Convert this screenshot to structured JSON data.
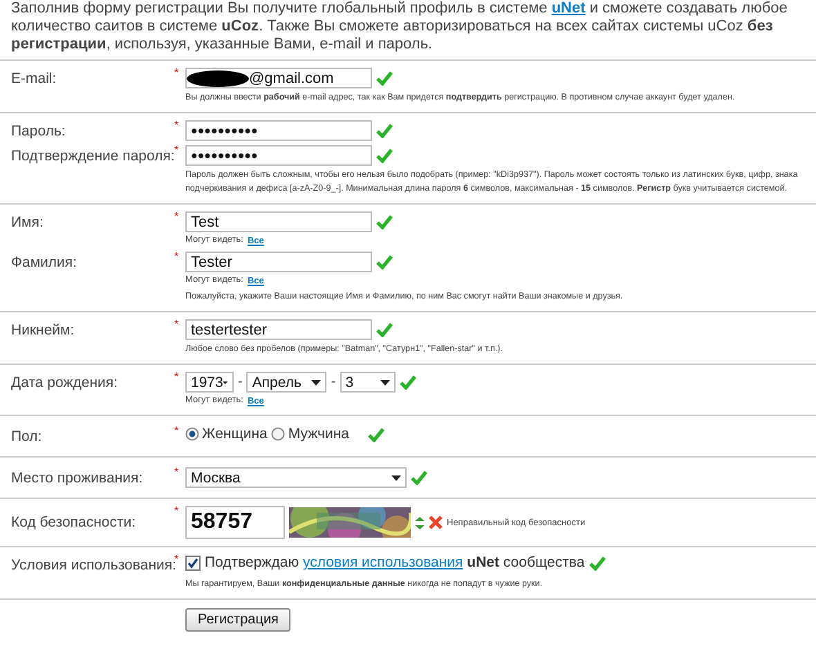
{
  "intro": {
    "before": "Заполнив форму регистрации Вы получите глобальный профиль в системе",
    "link": "uNet",
    "after": "и сможете создавать любое количество саитов в системе **uCoz**. Также Вы сможете авторизироваться на всех сайтах системы uCoz **без регистрации**, используя, указанные Вами, e-mail и пароль."
  },
  "sections": [
    {
      "rows": [
        {
          "kind": "text",
          "label": "E-mail:",
          "required": "*",
          "value": "@gmail.com",
          "redacted": true,
          "valid": true
        }
      ],
      "hint": "Вы должны ввести **рабочий** e-mail адрес, так как Вам придется **подтвердить** регистрацию. В противном случае аккаунт будет удален."
    },
    {
      "rows": [
        {
          "kind": "password",
          "label": "Пароль:",
          "required": "*",
          "value": "●●●●●●●●●●",
          "valid": true
        },
        {
          "kind": "password",
          "label": "Подтверждение пароля:",
          "required": "*",
          "value": "●●●●●●●●●●",
          "valid": true
        }
      ],
      "hint": "Пароль должен быть сложным, чтобы его нельзя было подобрать (пример: \"kDi3p937\"). Пароль может состоять только из латинских букв, цифр, знака подчеркивания и дефиса [a-zA-Z0-9_-]. Минимальная длина пароля **6** символов, максимальная - **15** символов. **Регистр** букв учитывается системой."
    },
    {
      "rows": [
        {
          "kind": "text",
          "label": "Имя:",
          "required": "*",
          "value": "Test",
          "valid": true,
          "visibility": {
            "label": "Могут видеть:",
            "link": "Все"
          }
        },
        {
          "kind": "text",
          "label": "Фамилия:",
          "required": "*",
          "value": "Tester",
          "valid": true,
          "visibility": {
            "label": "Могут видеть:",
            "link": "Все"
          }
        }
      ],
      "hint": "Пожалуйста, укажите Ваши настоящие Имя и Фамилию, по ним Вас смогут найти Ваши знакомые и друзья."
    },
    {
      "rows": [
        {
          "kind": "text",
          "label": "Никнейм:",
          "required": "*",
          "value": "testertester",
          "valid": true
        }
      ],
      "hint": "Любое слово без пробелов (примеры: \"Batman\", \"Сатурн1\", \"Fallen-star\" и т.п.)."
    },
    {
      "rows": [
        {
          "kind": "date",
          "label": "Дата рождения:",
          "required": "*",
          "selects": [
            "1973",
            "Апрель",
            "3"
          ],
          "separator": "-",
          "valid": true,
          "visibility": {
            "label": "Могут видеть:",
            "link": "Все"
          }
        }
      ]
    },
    {
      "rows": [
        {
          "kind": "radio",
          "label": "Пол:",
          "required": "*",
          "options": [
            {
              "label": "Женщина",
              "selected": true
            },
            {
              "label": "Мужчина",
              "selected": false
            }
          ],
          "valid": true
        }
      ]
    },
    {
      "rows": [
        {
          "kind": "select",
          "label": "Место проживания:",
          "required": "*",
          "value": "Москва",
          "valid": true
        }
      ]
    },
    {
      "rows": [
        {
          "kind": "captcha",
          "label": "Код безопасности:",
          "required": "*",
          "value": "58757",
          "valid": false,
          "message": "Неправильный код безопасности"
        }
      ]
    },
    {
      "rows": [
        {
          "kind": "checkbox",
          "label": "Условия использования:",
          "required": "*",
          "checked": true,
          "before": "Подтверждаю",
          "link": "условия использования",
          "after": "**uNet** сообщества",
          "valid": true
        }
      ],
      "hint": "Мы гарантируем, Ваши **конфиденциальные данные** никогда не попадут в чужие руки."
    }
  ],
  "submit": "Регистрация"
}
